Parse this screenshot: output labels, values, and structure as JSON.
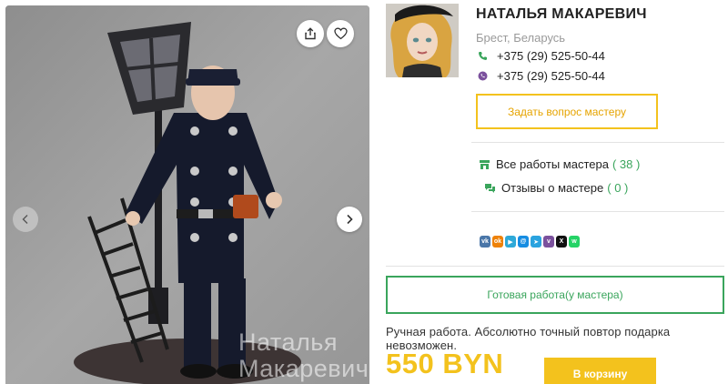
{
  "gallery": {
    "watermark": "Наталья\nМакаревич",
    "share_icon": "share-icon",
    "favorite_icon": "heart-icon",
    "prev_icon": "chevron-left-icon",
    "next_icon": "chevron-right-icon"
  },
  "seller": {
    "name": "НАТАЛЬЯ МАКАРЕВИЧ",
    "location": "Брест, Беларусь",
    "phones": [
      {
        "icon": "phone-icon",
        "number": "+375 (29) 525-50-44"
      },
      {
        "icon": "viber-icon",
        "number": "+375 (29) 525-50-44"
      }
    ],
    "ask_button": "Задать вопрос мастеру"
  },
  "links": {
    "all_works_label": "Все работы мастера",
    "all_works_count": "( 38 )",
    "reviews_label": "Отзывы о мастере",
    "reviews_count": "( 0 )"
  },
  "share_services": [
    {
      "name": "vk",
      "glyph": "vk",
      "color": "#4a76a8"
    },
    {
      "name": "odnoklassniki",
      "glyph": "ok",
      "color": "#ee8208"
    },
    {
      "name": "yandex-messenger",
      "glyph": "▶",
      "color": "#2ea9d8"
    },
    {
      "name": "moimir",
      "glyph": "@",
      "color": "#168de2"
    },
    {
      "name": "telegram",
      "glyph": "➤",
      "color": "#2aa3df"
    },
    {
      "name": "viber",
      "glyph": "v",
      "color": "#7b519d"
    },
    {
      "name": "x",
      "glyph": "X",
      "color": "#111111"
    },
    {
      "name": "whatsapp",
      "glyph": "w",
      "color": "#25d366"
    }
  ],
  "product": {
    "status_button": "Готовая работа(у мастера)",
    "note": "Ручная работа. Абсолютно точный повтор подарка невозможен.",
    "price": "550 BYN",
    "cart_button": "В корзину"
  },
  "colors": {
    "accent_yellow": "#f3c21d",
    "accent_green": "#3aa55c"
  }
}
